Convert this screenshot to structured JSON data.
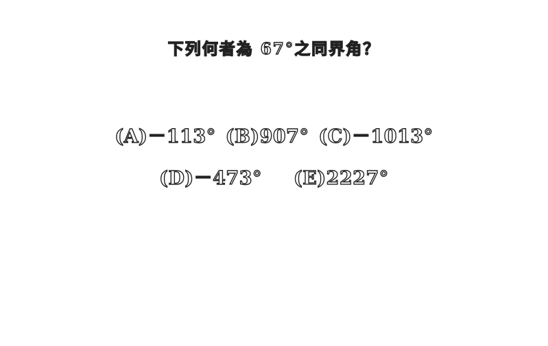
{
  "question": "下列何者為 67°之同界角？",
  "options": [
    {
      "letter": "(A)",
      "value": "－113°"
    },
    {
      "letter": "(B)",
      "value": "907°"
    },
    {
      "letter": "(C)",
      "value": "－1013°"
    },
    {
      "letter": "(D)",
      "value": "－473°"
    },
    {
      "letter": "(E)",
      "value": "2227°"
    }
  ],
  "colors": {
    "background": "#ffffff",
    "text_fill": "#ffffff",
    "text_outline": "#222222"
  }
}
